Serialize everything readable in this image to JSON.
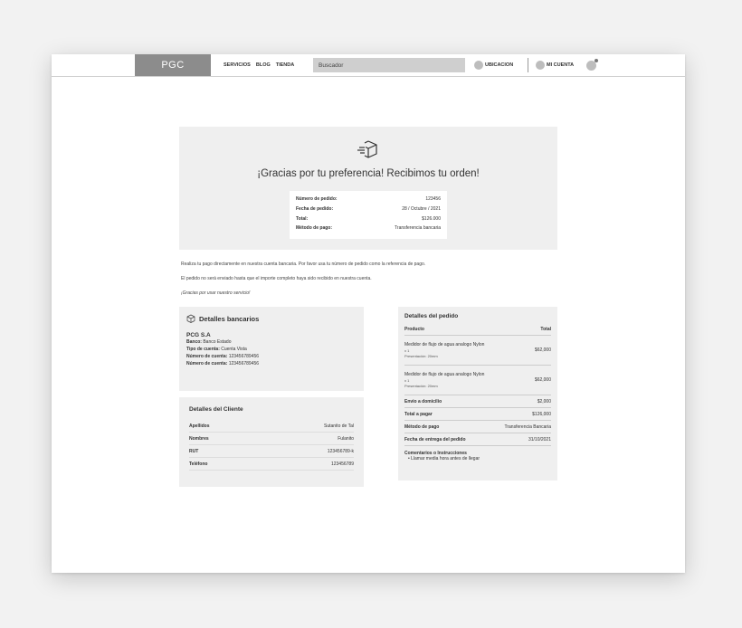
{
  "nav": {
    "logo": "PGC",
    "links": [
      "SERVICIOS",
      "BLOG",
      "TIENDA"
    ],
    "search_placeholder": "Buscador",
    "location_label": "UBICACION",
    "account_label": "MI CUENTA"
  },
  "hero": {
    "title": "¡Gracias por tu preferencia! Recibimos tu orden!",
    "summary": [
      {
        "label": "Número de pedido:",
        "value": "123456"
      },
      {
        "label": "Fecha de pedido:",
        "value": "28 / Octubre / 2021"
      },
      {
        "label": "Total:",
        "value": "$126.000"
      },
      {
        "label": "Método de pago:",
        "value": "Transferencia bancaria"
      }
    ]
  },
  "messages": {
    "line1": "Realiza tu pago directamente en nuestra cuenta bancaria. Por favor usa tu número de pedido como la referencia de pago.",
    "line2": "El pedido no será enviado hasta que el importe completo haya sido recibido en nuestra cuenta.",
    "line3": "¡Gracias por usar nuestro servicio!"
  },
  "bank": {
    "title": "Detalles bancarios",
    "name": "PCG S.A",
    "lines": [
      {
        "label": "Banco:",
        "value": "Banco Estado"
      },
      {
        "label": "Tipo de cuenta:",
        "value": "Cuenta Vista"
      },
      {
        "label": "Número de cuenta:",
        "value": "123456789456"
      },
      {
        "label": "Número de cuenta:",
        "value": "123456789456"
      }
    ]
  },
  "client": {
    "title": "Detalles del Cliente",
    "rows": [
      {
        "label": "Apellidos",
        "value": "Sutanito de Tal"
      },
      {
        "label": "Nombres",
        "value": "Fulanito"
      },
      {
        "label": "RUT",
        "value": "123456789-k"
      },
      {
        "label": "Teléfono",
        "value": "123456789"
      }
    ]
  },
  "order": {
    "title": "Detalles del pedido",
    "col_product": "Producto",
    "col_total": "Total",
    "items": [
      {
        "name": "Medidor de flujo de agua analogo Nylon",
        "qty": "x 1",
        "presentation": "Presentación:  20mm",
        "price": "$62,000"
      },
      {
        "name": "Medidor de flujo de agua analogo Nylon",
        "qty": "x 1",
        "presentation": "Presentación:  20mm",
        "price": "$62,000"
      }
    ],
    "rows": [
      {
        "label": "Envio a domicilio",
        "value": "$2,000"
      },
      {
        "label": "Total a pagar",
        "value": "$126,000"
      },
      {
        "label": "Método de pago",
        "value": "Transferencia Bancaria"
      },
      {
        "label": "Fecha de entrega del pedido",
        "value": "31/10/2021"
      }
    ],
    "comments_label": "Comentarios o Instrucciones",
    "comments": "•  Llamar media hora antes de llegar"
  },
  "colors": {
    "logo_bg": "#8c8c8c",
    "panel_bg": "#efefef",
    "search_bg": "#cfcfcf"
  }
}
